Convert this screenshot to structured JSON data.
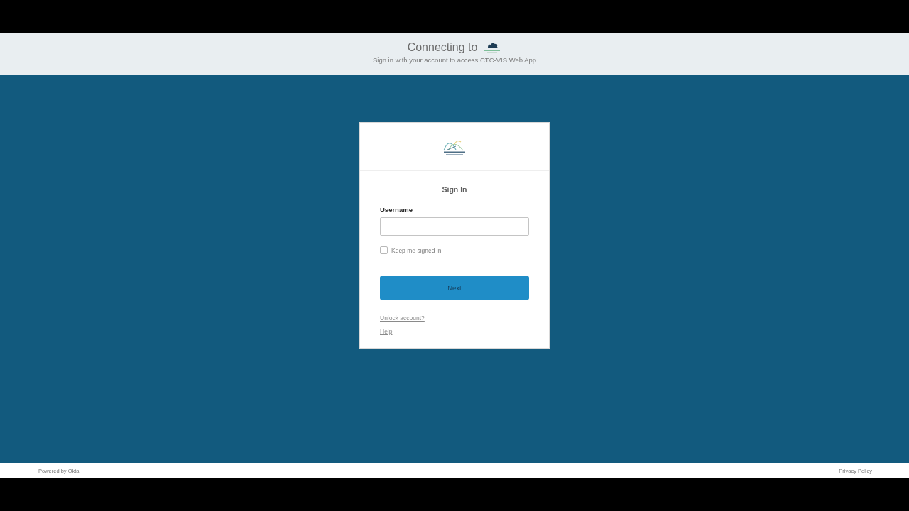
{
  "header": {
    "title": "Connecting to",
    "subtitle": "Sign in with your account to access CTC-VIS Web App"
  },
  "card": {
    "heading": "Sign In",
    "username": {
      "label": "Username"
    },
    "remember": {
      "label": "Keep me signed in",
      "checked": false
    },
    "submit": {
      "label": "Next"
    },
    "links": [
      "Unlock account?",
      "Help"
    ]
  },
  "footer": {
    "left": "Powered by Okta",
    "right": "Privacy Policy"
  }
}
